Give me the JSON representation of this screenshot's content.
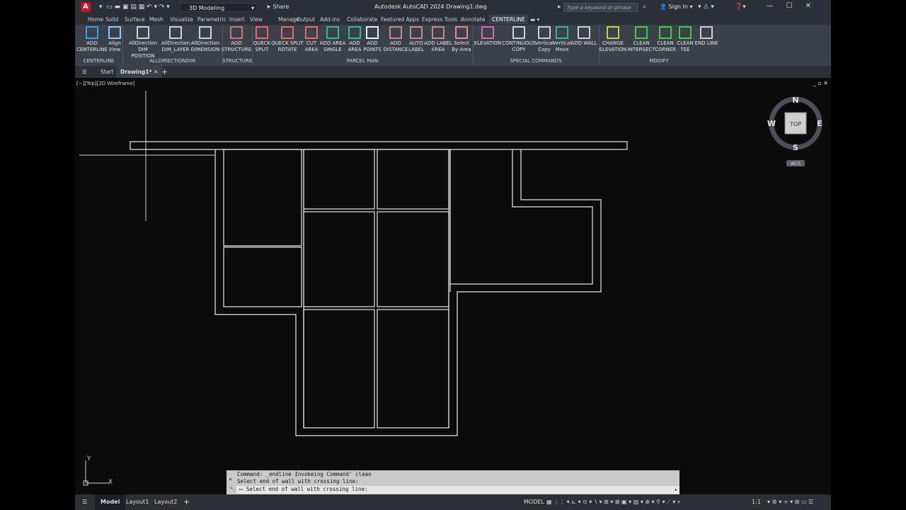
{
  "titlebar": {
    "logo": "A",
    "workspace": "3D Modeling",
    "share": "Share",
    "title": "Autodesk AutoCAD 2024   Drawing1.dwg",
    "search_placeholder": "Type a keyword or phrase",
    "signin": "Sign In"
  },
  "menu_tabs": [
    "Home",
    "Solid",
    "Surface",
    "Mesh",
    "Visualize",
    "Parametric",
    "Insert",
    "View",
    "Manage",
    "Output",
    "Add-ins",
    "Collaborate",
    "Featured Apps",
    "Express Tools",
    "Annotate",
    "CENTERLINE"
  ],
  "ribbon": {
    "buttons": [
      {
        "l1": "ADD",
        "l2": "CENTERLINE"
      },
      {
        "l1": "Align",
        "l2": "View"
      },
      {
        "l1": "AllDirection",
        "l2": "DIM POSITION"
      },
      {
        "l1": "AllDirection",
        "l2": "DIM_LAYER"
      },
      {
        "l1": "AllDirection",
        "l2": "DIMENSION"
      },
      {
        "l1": "ADD",
        "l2": "STRUCTURE"
      },
      {
        "l1": "QUECK",
        "l2": "SPLIT"
      },
      {
        "l1": "QUECK SPLIT",
        "l2": "ROTATE"
      },
      {
        "l1": "CUT",
        "l2": "AREA"
      },
      {
        "l1": "ADD AREA",
        "l2": "SINGLE"
      },
      {
        "l1": "ADD",
        "l2": "AREA"
      },
      {
        "l1": "ADD",
        "l2": "POINTS"
      },
      {
        "l1": "ADD",
        "l2": "DISTANCE"
      },
      {
        "l1": "AUTO",
        "l2": "LABEL"
      },
      {
        "l1": "ADD LABEL",
        "l2": "AREA"
      },
      {
        "l1": "Select",
        "l2": "By Area"
      },
      {
        "l1": "ELEVATION",
        "l2": ""
      },
      {
        "l1": "CONTINUOUS",
        "l2": "COPY"
      },
      {
        "l1": "Vertical",
        "l2": "Copy"
      },
      {
        "l1": "Vertical",
        "l2": "Move"
      },
      {
        "l1": "ADD WALL",
        "l2": ""
      },
      {
        "l1": "CHANGE",
        "l2": "ELEVATION"
      },
      {
        "l1": "CLEAN",
        "l2": "INTERSECT"
      },
      {
        "l1": "CLEAN",
        "l2": "CORNER"
      },
      {
        "l1": "CLEAN",
        "l2": "TEE"
      },
      {
        "l1": "END LINE",
        "l2": ""
      }
    ],
    "panels": [
      "CENTERLINE",
      "ALLDIRECTIONDIM",
      "STRUCTURE",
      "PARCEL MAN",
      "SPECIAL COMMANDS",
      "MODIFY"
    ]
  },
  "doc_tabs": {
    "start": "Start",
    "drawing": "Drawing1*"
  },
  "viewport": {
    "label": "[−][Top][2D Wireframe]",
    "viewcube": {
      "n": "N",
      "s": "S",
      "e": "E",
      "w": "W",
      "face": "TOP",
      "ucs": "WCS"
    },
    "ucs_x": "X",
    "ucs_y": "Y"
  },
  "command": {
    "line1": "Command: _endline Invokeing Command' clean",
    "line2": "Select end of wall with crossing line:",
    "prompt": "Select end of wall with crossing line:"
  },
  "status": {
    "model": "Model",
    "layout1": "Layout1",
    "layout2": "Layout2",
    "space": "MODEL",
    "scale": "1:1"
  },
  "colors": {
    "accent": "#0696d7",
    "logo_red": "#c8102e",
    "canvas": "#0b0b0c",
    "wall": "#e8e8e8"
  }
}
